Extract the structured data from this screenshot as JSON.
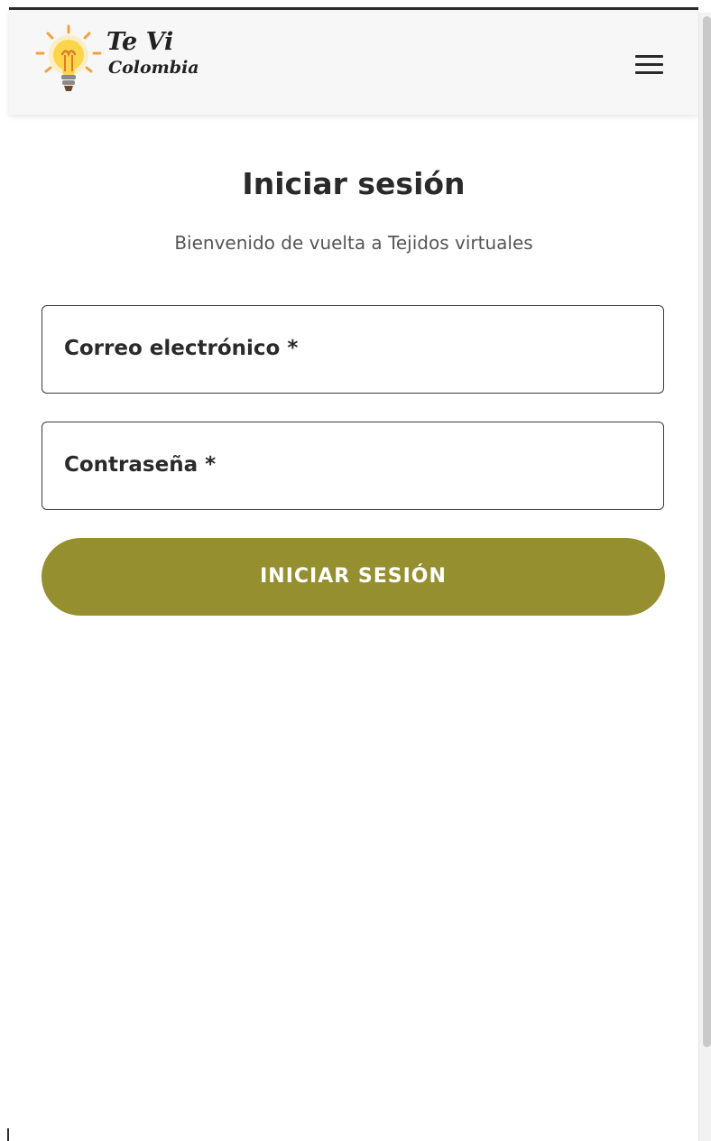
{
  "brand": {
    "logo_line1": "Te Vi",
    "logo_line2": "Colombia",
    "accent_color": "#958f30"
  },
  "header": {
    "menu_icon": "hamburger-menu-icon",
    "logo_icon": "lightbulb-icon"
  },
  "login": {
    "title": "Iniciar sesión",
    "subtitle": "Bienvenido de vuelta a Tejidos virtuales",
    "email_label": "Correo electrónico *",
    "password_label": "Contraseña *",
    "submit_label": "INICIAR SESIÓN"
  }
}
